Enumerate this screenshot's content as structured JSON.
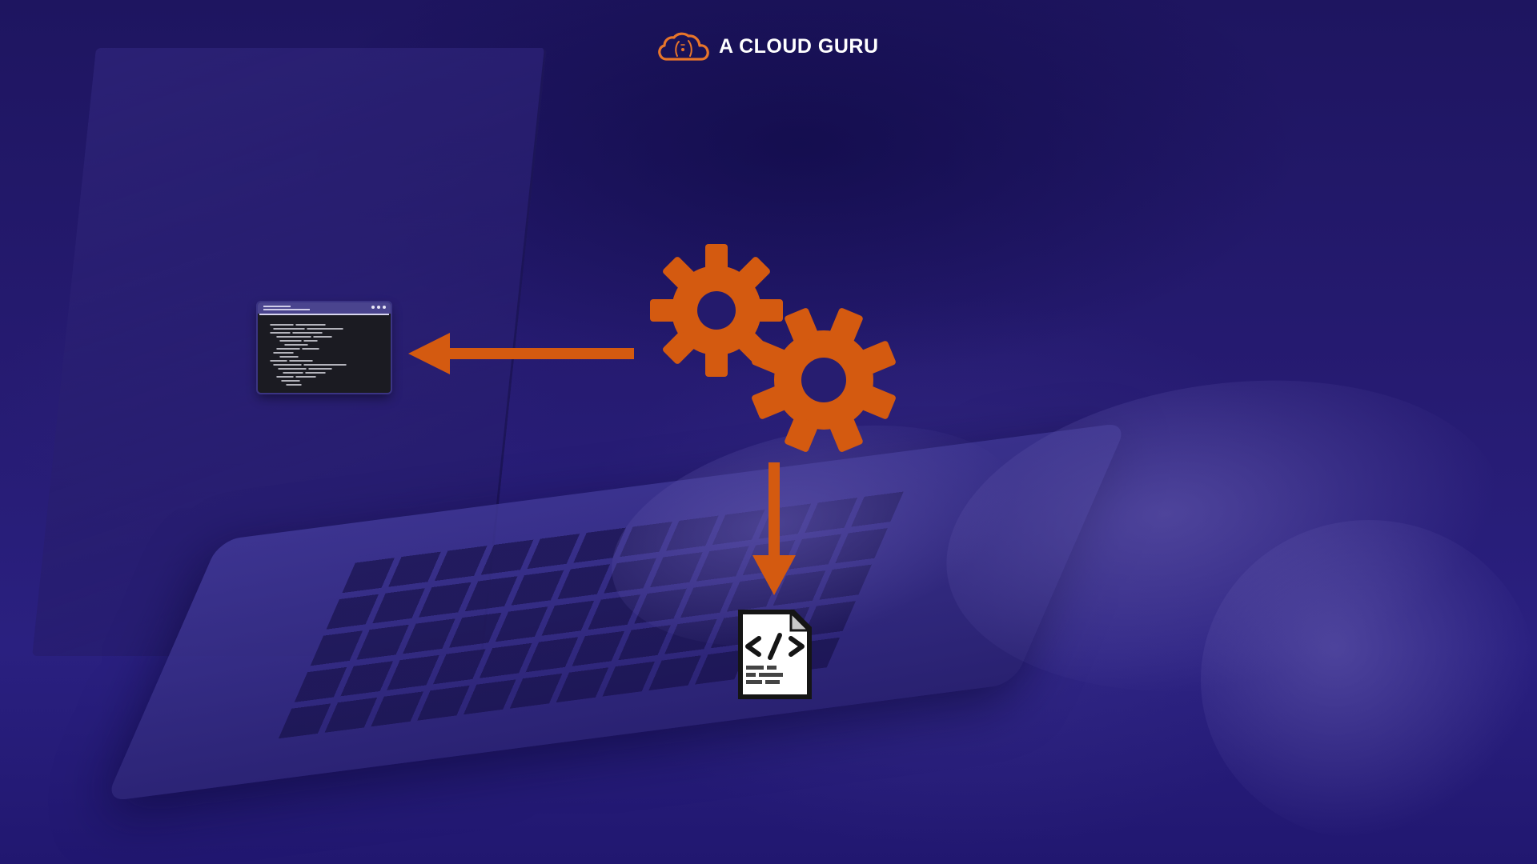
{
  "brand": {
    "name": "A CLOUD GURU",
    "logo_icon": "cloud-logo-icon",
    "accent_color": "#e8752a"
  },
  "diagram": {
    "nodes": [
      {
        "id": "terminal",
        "icon": "terminal-window-icon",
        "label": ""
      },
      {
        "id": "process",
        "icon": "gears-icon",
        "label": ""
      },
      {
        "id": "code-file",
        "icon": "code-file-icon",
        "label": ""
      }
    ],
    "edges": [
      {
        "from": "process",
        "to": "terminal",
        "icon": "arrow-left-icon"
      },
      {
        "from": "process",
        "to": "code-file",
        "icon": "arrow-down-icon"
      }
    ]
  },
  "colors": {
    "background": "#24186a",
    "accent": "#d45a10",
    "text": "#ffffff"
  }
}
